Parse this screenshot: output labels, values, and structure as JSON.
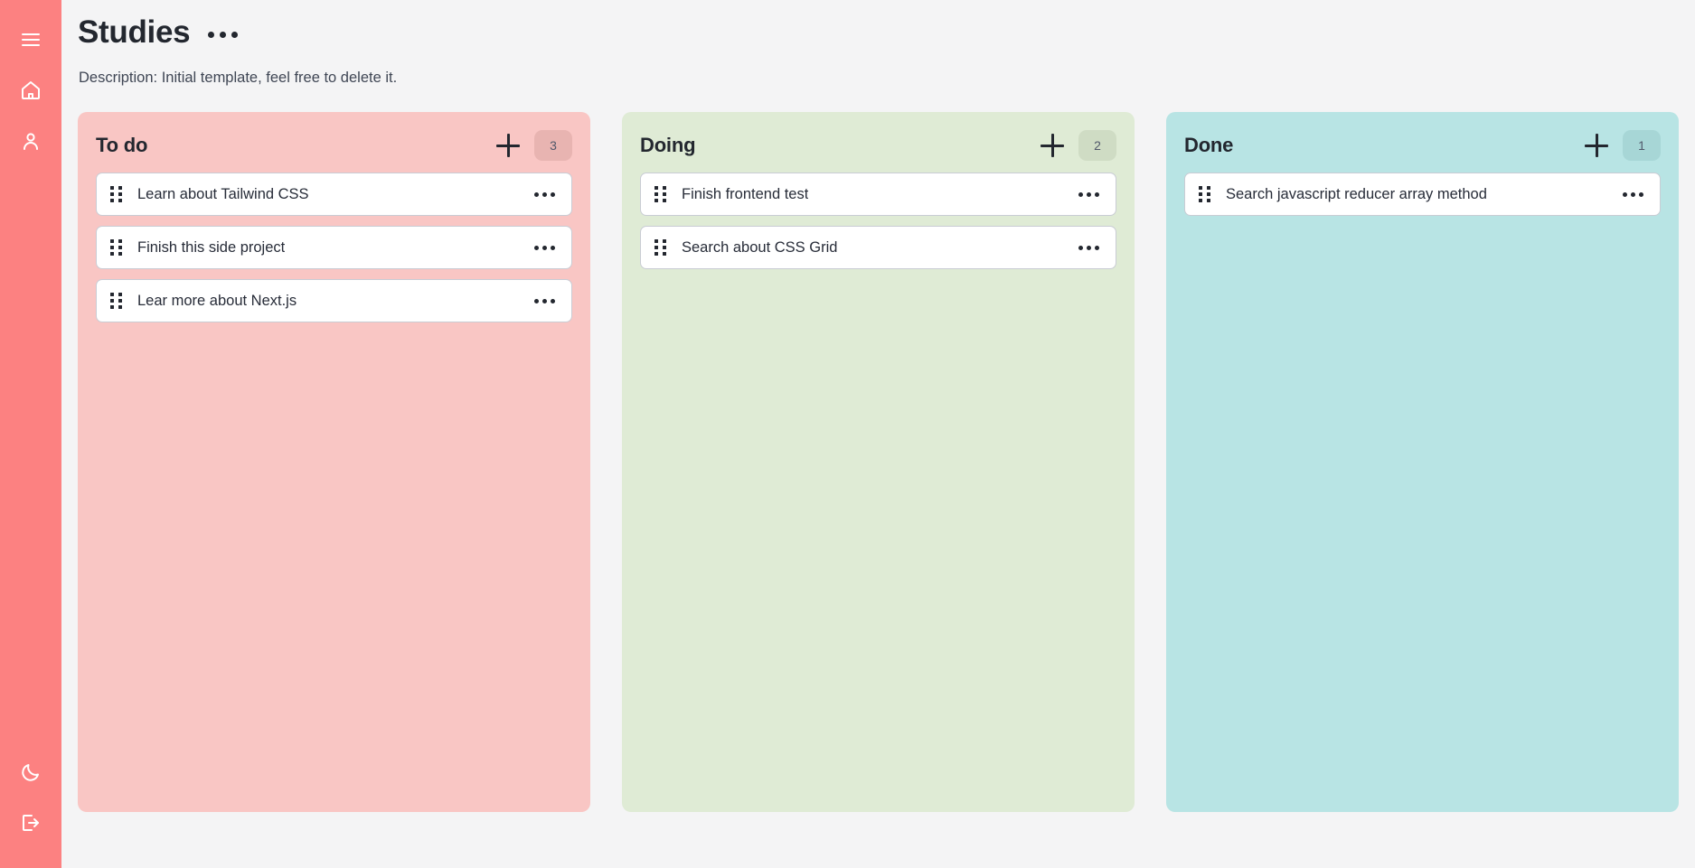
{
  "sidebar": {
    "background": "#fc8181",
    "top_items": [
      {
        "name": "menu-toggle",
        "icon": "hamburger-menu-icon",
        "label": "Menu"
      },
      {
        "name": "home",
        "icon": "home-icon",
        "label": "Home"
      },
      {
        "name": "profile",
        "icon": "user-icon",
        "label": "Profile"
      }
    ],
    "bottom_items": [
      {
        "name": "theme-toggle",
        "icon": "moon-icon",
        "label": "Dark mode"
      },
      {
        "name": "logout",
        "icon": "logout-icon",
        "label": "Log out"
      }
    ]
  },
  "header": {
    "title": "Studies",
    "menu_icon": "ellipsis-icon",
    "description": "Description: Initial template, feel free to delete it."
  },
  "board": {
    "background": "#f4f4f5",
    "columns": [
      {
        "id": "todo",
        "name": "To do",
        "count": "3",
        "color": "#f9c6c4",
        "badge_color": "#e8b4b1",
        "add_label": "+",
        "cards": [
          {
            "title": "Learn about Tailwind CSS"
          },
          {
            "title": "Finish this side project"
          },
          {
            "title": "Lear more about Next.js"
          }
        ]
      },
      {
        "id": "doing",
        "name": "Doing",
        "count": "2",
        "color": "#dfebd5",
        "badge_color": "#cfdcc4",
        "add_label": "+",
        "cards": [
          {
            "title": "Finish frontend test"
          },
          {
            "title": "Search about CSS Grid"
          }
        ]
      },
      {
        "id": "done",
        "name": "Done",
        "count": "1",
        "color": "#b8e4e4",
        "badge_color": "#a7d6d6",
        "add_label": "+",
        "cards": [
          {
            "title": "Search javascript reducer array method"
          }
        ]
      }
    ]
  }
}
